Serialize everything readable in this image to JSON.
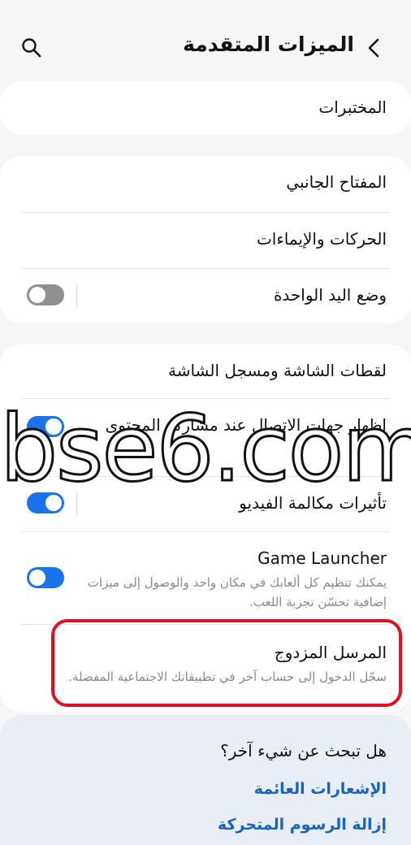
{
  "header": {
    "title": "الميزات المتقدمة"
  },
  "items": {
    "labs": "المختبرات",
    "side_key": "المفتاح الجانبي",
    "motions": "الحركات والإيماءات",
    "one_hand": "وضع اليد الواحدة",
    "screenshots": "لقطات الشاشة ومسجل الشاشة",
    "show_contacts": "اظهار جهات الاتصال عند مشاركة المحتوى",
    "video_call": "تأثيرات مكالمة الفيديو",
    "game_launcher_title": "Game Launcher",
    "game_launcher_desc": "يمكنك تنظيم كل ألعابك في مكان واحد والوصول إلى ميزات إضافية تحسّن تجربة اللعب.",
    "dual_messenger_title": "المرسل المزدوج",
    "dual_messenger_desc": "سجّل الدخول إلى حساب آخر في تطبيقاتك الاجتماعية المفضلة."
  },
  "toggles": {
    "one_hand": false,
    "show_contacts": true,
    "video_call": true,
    "game_launcher": false
  },
  "footer": {
    "question": "هل تبحث عن شيء آخر؟",
    "link1": "الإشعارات العائمة",
    "link2": "إزالة الرسوم المتحركة"
  },
  "watermark": "bse6.com",
  "colors": {
    "accent": "#1a73e8",
    "highlight": "#e10f1f",
    "link": "#1565c0"
  }
}
